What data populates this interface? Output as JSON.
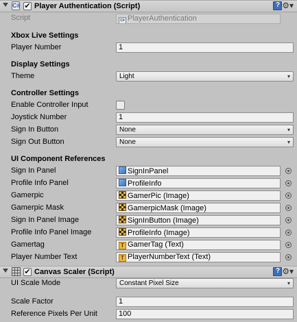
{
  "player_auth": {
    "title": "Player Authentication (Script)",
    "enabled_mark": "✔",
    "script_icon": "C#",
    "script_label": "Script",
    "script_value": "PlayerAuthentication",
    "xbox_section": "Xbox Live Settings",
    "player_number_label": "Player Number",
    "player_number_value": "1",
    "display_section": "Display Settings",
    "theme_label": "Theme",
    "theme_value": "Light",
    "controller_section": "Controller Settings",
    "enable_controller_label": "Enable Controller Input",
    "enable_controller_checked": false,
    "joystick_label": "Joystick Number",
    "joystick_value": "1",
    "sign_in_button_label": "Sign In Button",
    "sign_in_button_value": "None",
    "sign_out_button_label": "Sign Out Button",
    "sign_out_button_value": "None",
    "ui_section": "UI Component References",
    "refs": [
      {
        "label": "Sign In Panel",
        "value": "SignInPanel",
        "icon": "cube-icon"
      },
      {
        "label": "Profile Info Panel",
        "value": "ProfileInfo",
        "icon": "cube-icon"
      },
      {
        "label": "Gamerpic",
        "value": "GamerPic (Image)",
        "icon": "image-icon"
      },
      {
        "label": "Gamerpic Mask",
        "value": "GamerpicMask (Image)",
        "icon": "image-icon"
      },
      {
        "label": "Sign In Panel Image",
        "value": "SignInButton (Image)",
        "icon": "image-icon"
      },
      {
        "label": "Profile Info Panel Image",
        "value": "ProfileInfo (Image)",
        "icon": "image-icon"
      },
      {
        "label": "Gamertag",
        "value": "GamerTag (Text)",
        "icon": "text-icon"
      },
      {
        "label": "Player Number Text",
        "value": "PlayerNumberText (Text)",
        "icon": "text-icon"
      }
    ],
    "text_icon_glyph": "T"
  },
  "canvas_scaler": {
    "title": "Canvas Scaler (Script)",
    "enabled_mark": "✔",
    "ui_scale_mode_label": "UI Scale Mode",
    "ui_scale_mode_value": "Constant Pixel Size",
    "scale_factor_label": "Scale Factor",
    "scale_factor_value": "1",
    "ref_ppu_label": "Reference Pixels Per Unit",
    "ref_ppu_value": "100"
  },
  "icons": {
    "dropdown_arrow": "▾",
    "gear": "⚙▾",
    "fold": "foldout-arrow-icon"
  }
}
